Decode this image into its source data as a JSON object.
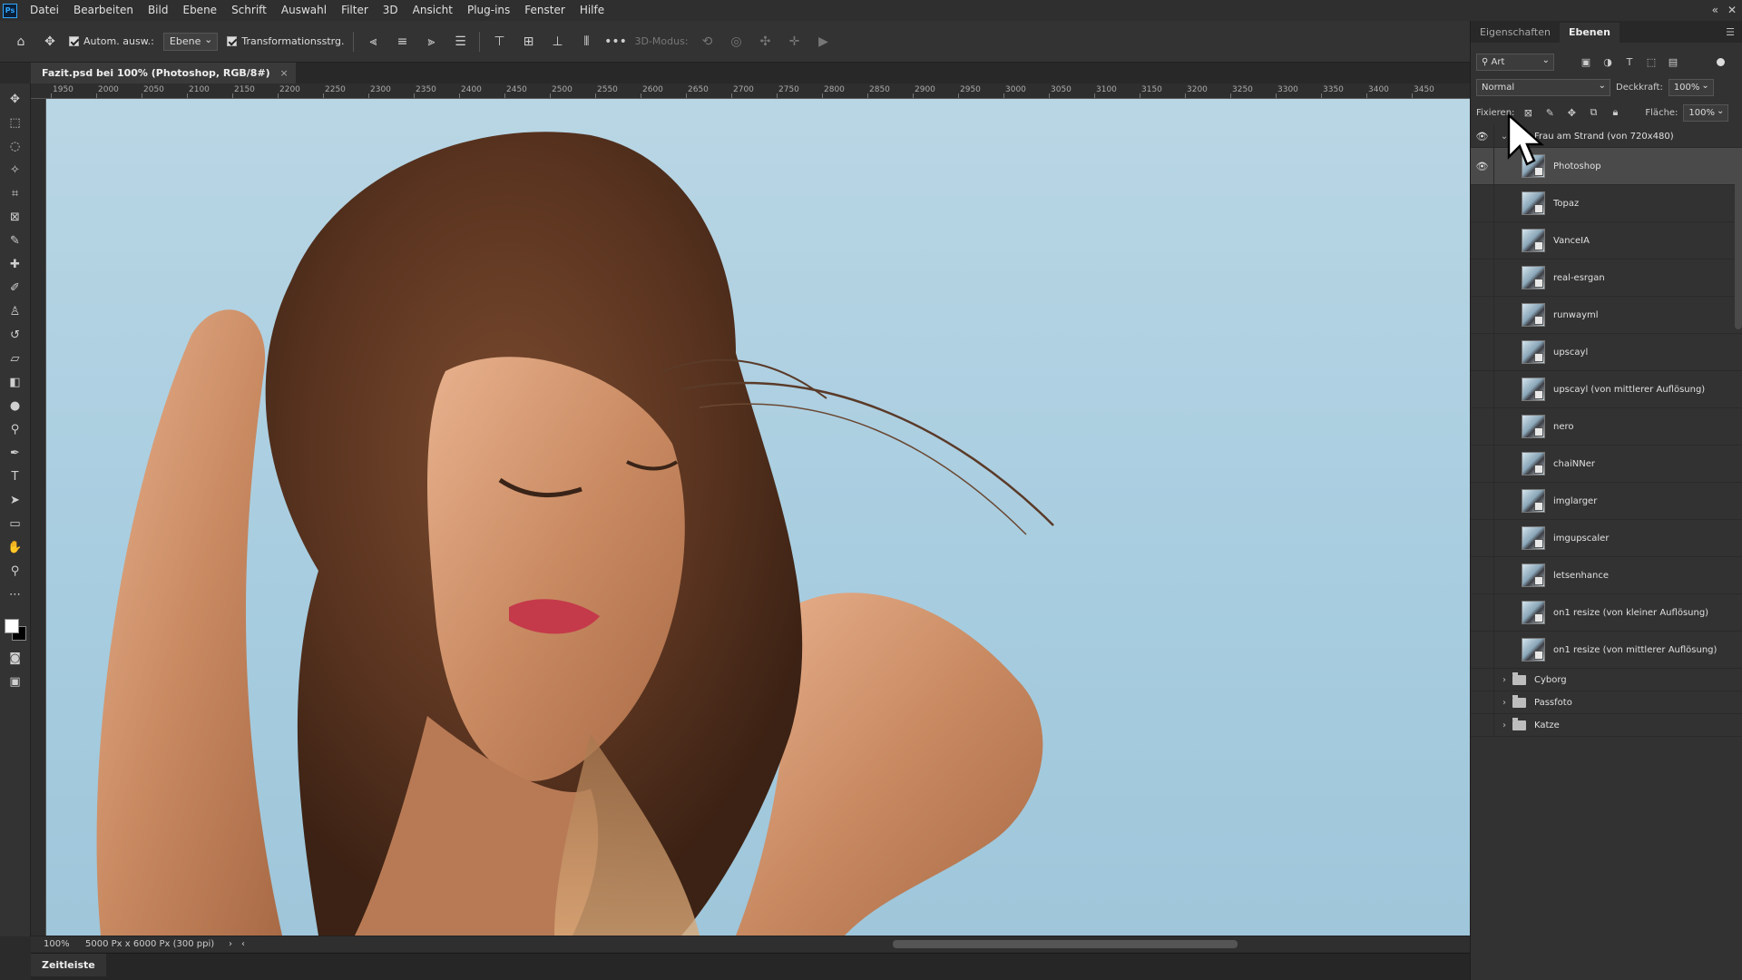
{
  "app": {
    "logo": "Ps",
    "menu": [
      "Datei",
      "Bearbeiten",
      "Bild",
      "Ebene",
      "Schrift",
      "Auswahl",
      "Filter",
      "3D",
      "Ansicht",
      "Plug-ins",
      "Fenster",
      "Hilfe"
    ],
    "window_controls": [
      "«",
      "✕"
    ]
  },
  "options_bar": {
    "auto_select_label": "Autom. ausw.:",
    "auto_select_target": "Ebene",
    "transform_label": "Transformationsstrg.",
    "more": "•••",
    "mode_3d_label": "3D-Modus:"
  },
  "document": {
    "tab_title": "Fazit.psd bei 100% (Photoshop, RGB/8#)",
    "tab_close": "×",
    "zoom": "100%",
    "doc_info": "5000 Px x 6000 Px (300 ppi)"
  },
  "ruler": {
    "top_labels": [
      "1950",
      "2000",
      "2050",
      "2100",
      "2150",
      "2200",
      "2250",
      "2300",
      "2350",
      "2400",
      "2450",
      "2500",
      "2550",
      "2600",
      "2650",
      "2700",
      "2750",
      "2800",
      "2850",
      "2900",
      "2950",
      "3000",
      "3050",
      "3100",
      "3150",
      "3200",
      "3250",
      "3300",
      "3350",
      "3400",
      "3450"
    ]
  },
  "timeline": {
    "label": "Zeitleiste"
  },
  "panel": {
    "tabs": [
      "Eigenschaften",
      "Ebenen"
    ],
    "active_tab": "Ebenen",
    "filter_kind": "Art",
    "blend_mode": "Normal",
    "opacity_label": "Deckkraft:",
    "opacity_value": "100%",
    "lock_label": "Fixieren:",
    "fill_label": "Fläche:",
    "fill_value": "100%",
    "group": {
      "name": "Frau am Strand (von 720x480)",
      "visible": true,
      "layers": [
        {
          "name": "Photoshop",
          "visible": true,
          "selected": true
        },
        {
          "name": "Topaz",
          "visible": false
        },
        {
          "name": "VanceIA",
          "visible": false
        },
        {
          "name": "real-esrgan",
          "visible": false
        },
        {
          "name": "runwayml",
          "visible": false
        },
        {
          "name": "upscayl",
          "visible": false
        },
        {
          "name": "upscayl (von mittlerer Auflösung)",
          "visible": false
        },
        {
          "name": "nero",
          "visible": false
        },
        {
          "name": "chaiNNer",
          "visible": false
        },
        {
          "name": "imglarger",
          "visible": false
        },
        {
          "name": "imgupscaler",
          "visible": false
        },
        {
          "name": "letsenhance",
          "visible": false
        },
        {
          "name": "on1 resize (von kleiner Auflösung)",
          "visible": false
        },
        {
          "name": "on1 resize (von mittlerer Auflösung)",
          "visible": false
        }
      ]
    },
    "folders": [
      "Cyborg",
      "Passfoto",
      "Katze"
    ]
  }
}
